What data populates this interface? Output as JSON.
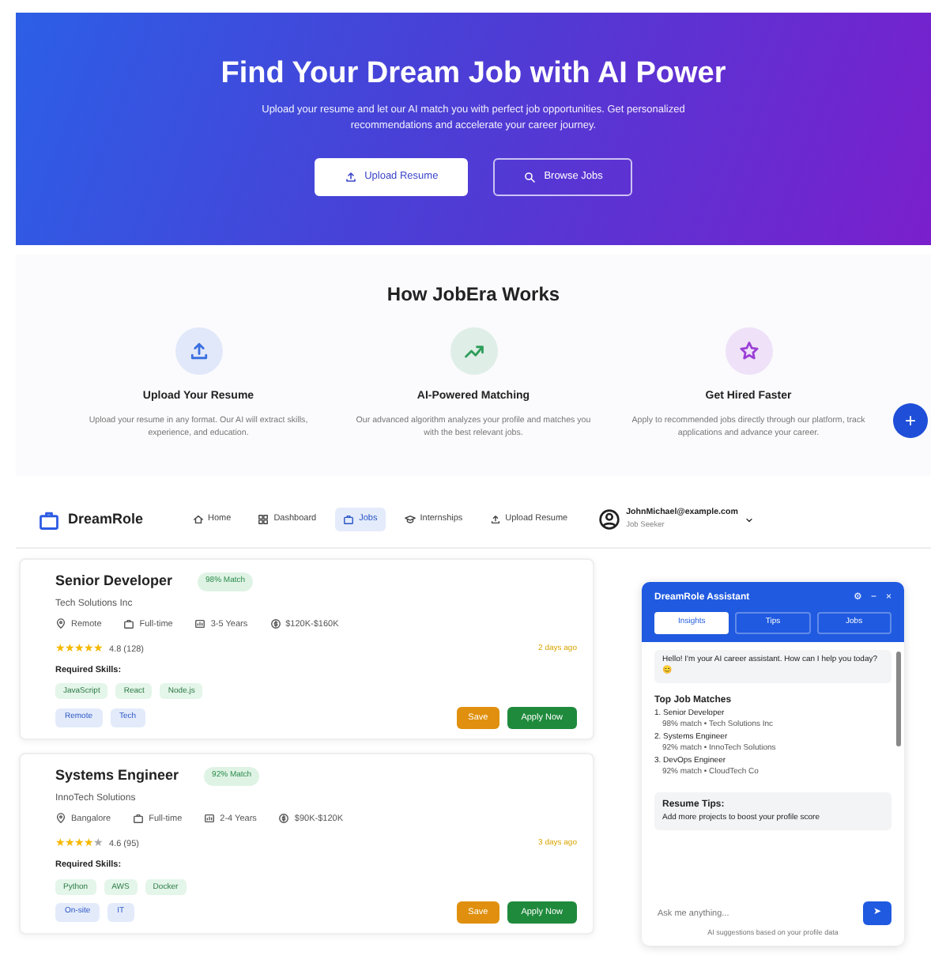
{
  "hero": {
    "title": "Find Your Dream Job with AI Power",
    "subtitle": "Upload your resume and let our AI match you with perfect job opportunities. Get personalized recommendations and accelerate your career journey.",
    "buttons": [
      {
        "label": "Upload Resume",
        "kind": "solid"
      },
      {
        "label": "Browse Jobs",
        "kind": "outline"
      }
    ]
  },
  "how_it_works": {
    "title": "How JobEra Works",
    "fab": "+",
    "steps": [
      {
        "kind": "upload",
        "color": "#3b6fe0",
        "title": "Upload Your Resume",
        "description": "Upload your resume in any format. Our AI will extract skills, experience, and education."
      },
      {
        "kind": "trend",
        "color": "#2e9e5a",
        "title": "AI-Powered Matching",
        "description": "Our advanced algorithm analyzes your profile and matches you with the best relevant jobs."
      },
      {
        "kind": "star",
        "color": "#9b3fd6",
        "title": "Get Hired Faster",
        "description": "Apply to recommended jobs directly through our platform, track applications and advance your career."
      }
    ]
  },
  "navbar": {
    "brand": "DreamRole",
    "items": [
      {
        "kind": "home",
        "label": "Home",
        "selected": false
      },
      {
        "kind": "dashboard",
        "label": "Dashboard",
        "selected": false
      },
      {
        "kind": "jobs",
        "label": "Jobs",
        "selected": true
      },
      {
        "kind": "internships",
        "label": "Internships",
        "selected": false
      },
      {
        "kind": "upload",
        "label": "Upload Resume",
        "selected": false
      }
    ],
    "user": {
      "email": "JohnMichael@example.com",
      "role": "Job Seeker"
    }
  },
  "jobs": [
    {
      "title": "Senior Developer",
      "match": "98% Match",
      "company": "Tech Solutions Inc",
      "meta": [
        {
          "kind": "location",
          "text": "Remote"
        },
        {
          "kind": "type",
          "text": "Full-time"
        },
        {
          "kind": "experience",
          "text": "3-5 Years"
        },
        {
          "kind": "salary",
          "text": "$120K-$160K"
        }
      ],
      "stars": 5,
      "rating": "4.8 (128)",
      "posted": "2 days ago",
      "skills_label": "Required Skills:",
      "skills": [
        "JavaScript",
        "React",
        "Node.js"
      ],
      "tags": [
        "Remote",
        "Tech"
      ],
      "save": "Save",
      "apply": "Apply Now"
    },
    {
      "title": "Systems Engineer",
      "match": "92% Match",
      "company": "InnoTech Solutions",
      "meta": [
        {
          "kind": "location",
          "text": "Bangalore"
        },
        {
          "kind": "type",
          "text": "Full-time"
        },
        {
          "kind": "experience",
          "text": "2-4 Years"
        },
        {
          "kind": "salary",
          "text": "$90K-$120K"
        }
      ],
      "stars": 4,
      "rating": "4.6 (95)",
      "posted": "3 days ago",
      "skills_label": "Required Skills:",
      "skills": [
        "Python",
        "AWS",
        "Docker"
      ],
      "tags": [
        "On-site",
        "IT"
      ],
      "save": "Save",
      "apply": "Apply Now"
    }
  ],
  "assistant": {
    "title": "DreamRole Assistant",
    "controls": [
      "⚙",
      "−",
      "×"
    ],
    "tabs": [
      {
        "label": "Insights",
        "selected": true
      },
      {
        "label": "Tips",
        "selected": false
      },
      {
        "label": "Jobs",
        "selected": false
      }
    ],
    "greeting": "Hello! I'm your AI career assistant. How can I help you today? 😊",
    "matches": {
      "title": "Top Job Matches",
      "items": [
        {
          "name": "1. Senior Developer",
          "detail": "98% match • Tech Solutions Inc"
        },
        {
          "name": "2. Systems Engineer",
          "detail": "92% match • InnoTech Solutions"
        },
        {
          "name": "3. DevOps Engineer",
          "detail": "92% match • CloudTech Co"
        }
      ]
    },
    "tips": {
      "title": "Resume Tips:",
      "text": "Add more projects to boost your profile score"
    },
    "input": {
      "placeholder": "Ask me anything..."
    },
    "send": "➤",
    "footer": "AI suggestions based on your profile data"
  }
}
